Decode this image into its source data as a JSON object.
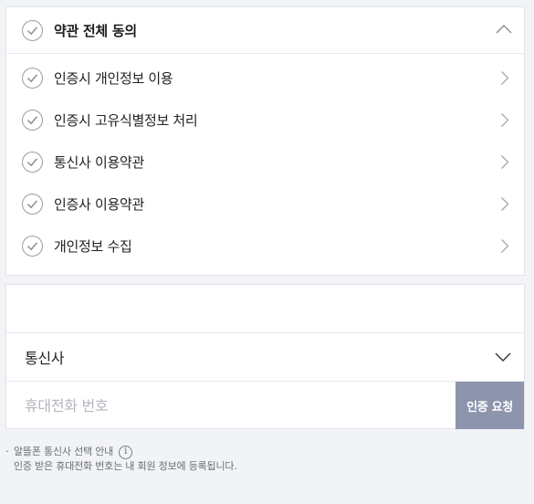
{
  "terms": {
    "all_agree_label": "약관 전체 동의",
    "items": [
      {
        "label": "인증시 개인정보 이용"
      },
      {
        "label": "인증시 고유식별정보 처리"
      },
      {
        "label": "통신사 이용약관"
      },
      {
        "label": "인증사 이용약관"
      },
      {
        "label": "개인정보 수집"
      }
    ]
  },
  "form": {
    "carrier_label": "통신사",
    "phone_placeholder": "휴대전화 번호",
    "phone_value": "",
    "request_button_label": "인증 요청"
  },
  "notice": {
    "bullet": "·",
    "line1": "알뜰폰 통신사 선택 안내",
    "info_glyph": "i",
    "line2": "인증 받은 휴대전화 번호는 내 회원 정보에 등록됩니다."
  },
  "colors": {
    "background": "#f2f3f7",
    "card": "#ffffff",
    "button": "#8d95ad",
    "check_stroke": "#9a9da6"
  },
  "icons": {
    "check": "check-circle-icon",
    "chevron_up": "chevron-up-icon",
    "chevron_right": "chevron-right-icon",
    "chevron_down": "chevron-down-icon",
    "info": "info-icon"
  }
}
